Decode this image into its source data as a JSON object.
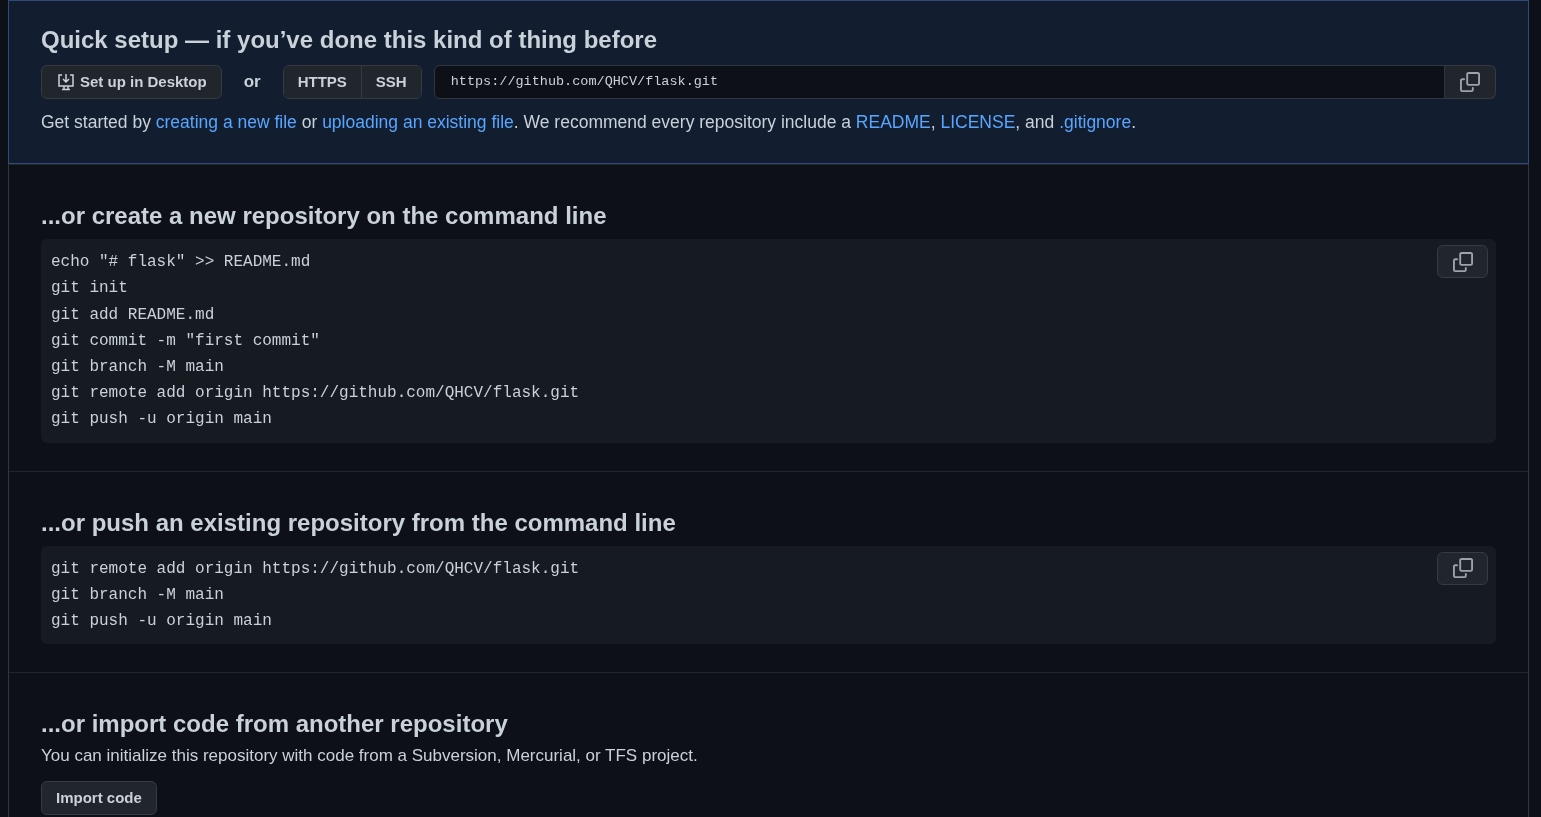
{
  "quick_setup": {
    "title": "Quick setup — if you’ve done this kind of thing before",
    "desktop_button": "Set up in Desktop",
    "or": "or",
    "protocols": [
      "HTTPS",
      "SSH"
    ],
    "clone_url": "https://github.com/QHCV/flask.git",
    "intro": [
      {
        "kind": "text",
        "text": "Get started by "
      },
      {
        "kind": "link",
        "text": "creating a new file"
      },
      {
        "kind": "text",
        "text": " or "
      },
      {
        "kind": "link",
        "text": "uploading an existing file"
      },
      {
        "kind": "text",
        "text": ". We recommend every repository include a "
      },
      {
        "kind": "link",
        "text": "README"
      },
      {
        "kind": "text",
        "text": ", "
      },
      {
        "kind": "link",
        "text": "LICENSE"
      },
      {
        "kind": "text",
        "text": ", and "
      },
      {
        "kind": "link",
        "text": ".gitignore"
      },
      {
        "kind": "text",
        "text": "."
      }
    ]
  },
  "sections": [
    {
      "title": "...or create a new repository on the command line",
      "code": [
        "echo \"# flask\" >> README.md",
        "git init",
        "git add README.md",
        "git commit -m \"first commit\"",
        "git branch -M main",
        "git remote add origin https://github.com/QHCV/flask.git",
        "git push -u origin main"
      ]
    },
    {
      "title": "...or push an existing repository from the command line",
      "code": [
        "git remote add origin https://github.com/QHCV/flask.git",
        "git branch -M main",
        "git push -u origin main"
      ]
    }
  ],
  "import": {
    "title": "...or import code from another repository",
    "description": "You can initialize this repository with code from a Subversion, Mercurial, or TFS project.",
    "button": "Import code"
  }
}
